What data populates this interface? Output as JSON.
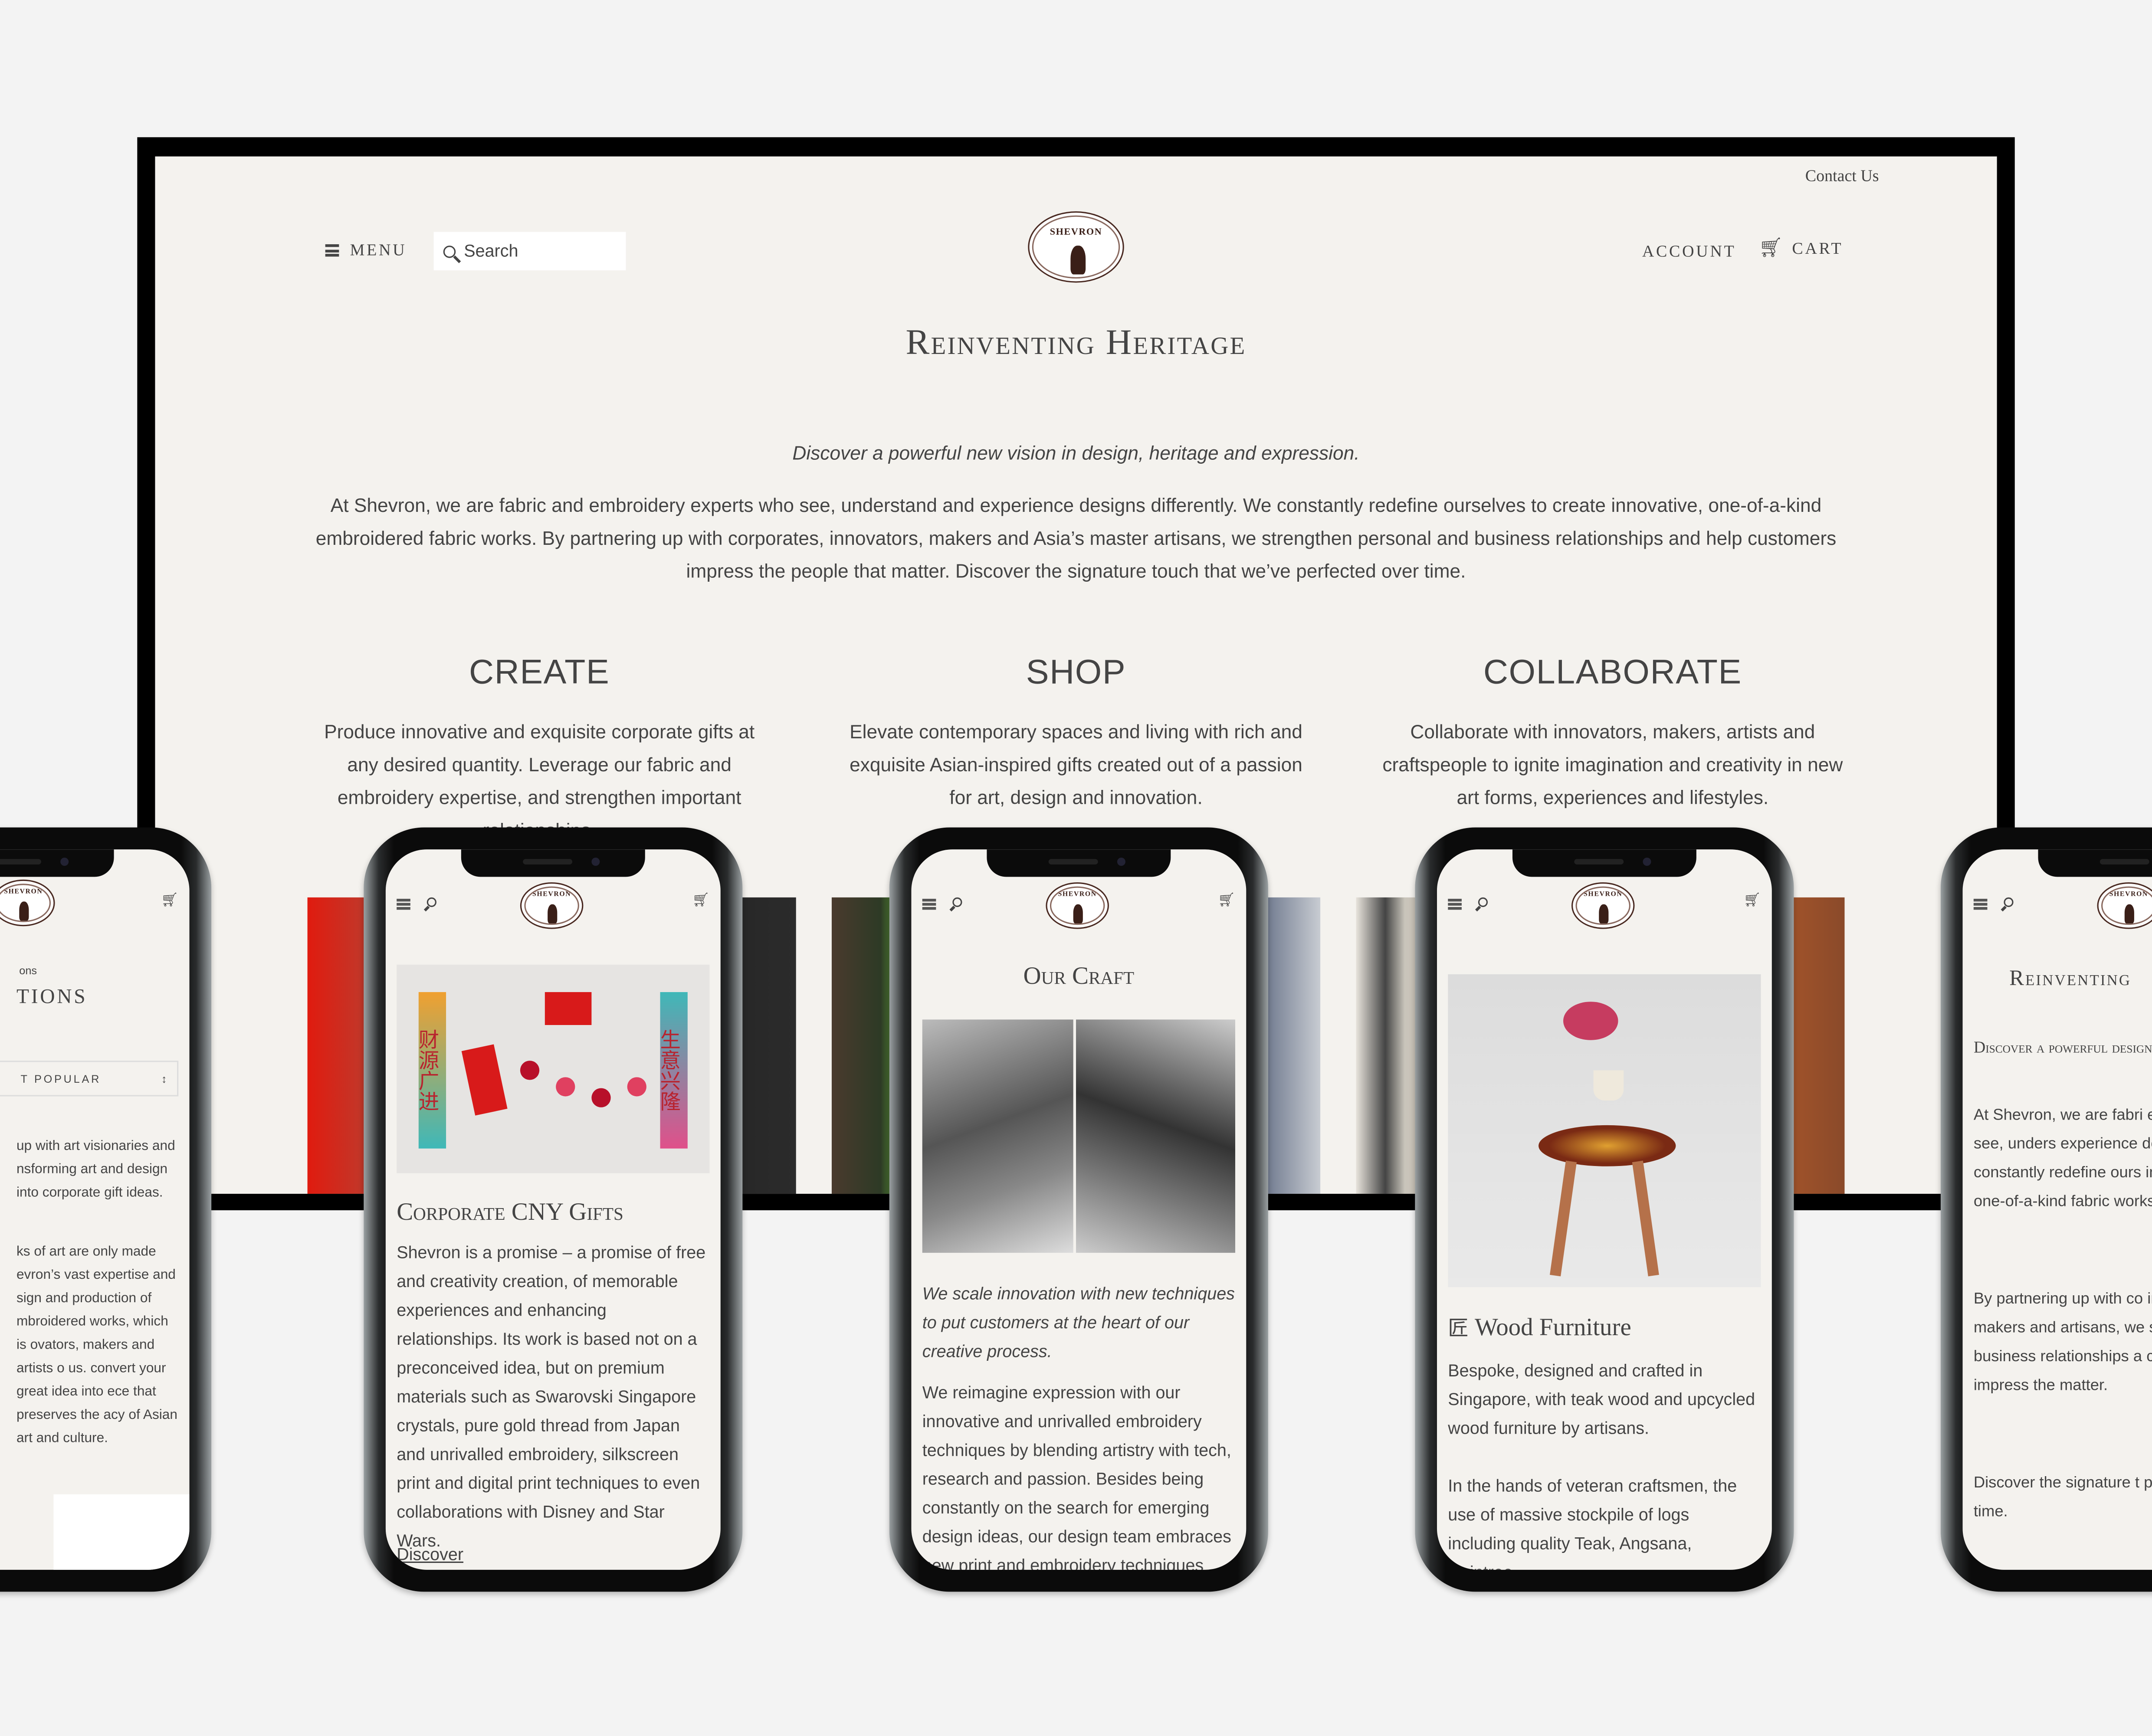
{
  "desktop": {
    "top_link": "Contact Us",
    "menu_label": "MENU",
    "search_placeholder": "Search",
    "logo_text": "SHEVRON",
    "account_label": "ACCOUNT",
    "cart_label": "CART",
    "cart_icon": "🛒",
    "heading": "Reinventing Heritage",
    "tagline": "Discover a powerful new vision in design, heritage and expression.",
    "intro": "At Shevron, we are fabric and embroidery experts who see, understand and experience designs differently. We constantly redefine ourselves to create innovative, one-of-a-kind embroidered fabric works. By partnering up with corporates, innovators, makers and Asia’s master artisans, we strengthen personal and business relationships and help customers impress the people that matter. Discover the signature touch that we’ve perfected over time.",
    "columns": [
      {
        "heading": "CREATE",
        "text": "Produce innovative and exquisite corporate gifts at any desired quantity. Leverage our fabric and embroidery expertise, and strengthen important relationships."
      },
      {
        "heading": "SHOP",
        "text": "Elevate contemporary spaces and living with rich and exquisite Asian-inspired gifts created out of a passion for art, design and innovation."
      },
      {
        "heading": "COLLABORATE",
        "text": "Collaborate with innovators, makers, artists and craftspeople to ignite imagination and creativity in new art forms, experiences and lifestyles."
      }
    ]
  },
  "phones": [
    {
      "breadcrumb": "ons",
      "title": "TIONS",
      "sort_value": "T POPULAR",
      "paragraph1": "up with art visionaries and nsforming art and design into corporate gift ideas.",
      "paragraph2": "ks of art are only made evron’s vast expertise and sign and production of mbroidered works, which is ovators, makers and artists o us. convert your great idea into ece that preserves the acy of Asian art and culture."
    },
    {
      "title": "Corporate CNY Gifts",
      "body": "Shevron is a promise – a promise of free and creativity creation, of memorable experiences and enhancing relationships. Its work is based not on a preconceived idea, but on premium materials such as Swarovski Singapore crystals, pure gold thread from Japan and unrivalled embroidery, silkscreen print and digital print techniques to even collaborations with Disney and Star Wars.",
      "link": "Discover",
      "banner_left": "财源广进",
      "banner_right": "生意兴隆"
    },
    {
      "title": "Our Craft",
      "quote": "We scale innovation with new techniques to put customers at the heart of our creative process.",
      "body": "We reimagine expression with our innovative and unrivalled embroidery techniques by blending artistry with tech, research and passion. Besides being constantly on the search for emerging design ideas, our design team embraces new print and embroidery techniques"
    },
    {
      "title_icon": "匠",
      "title": "Wood Furniture",
      "body1": "Bespoke, designed and crafted in Singapore, with teak wood and upcycled wood furniture by artisans.",
      "body2": "In the hands of veteran craftsmen, the use of massive stockpile of logs including quality Teak, Angsana, Raintree,"
    },
    {
      "title": "Reinventing",
      "subtitle": "Discover a powerful design, heritage and",
      "p1": "At Shevron, we are fabri experts who see, unders experience designs diffe constantly redefine ours innovative, one-of-a-kind fabric works.",
      "p2": "By partnering up with co innovators, makers and artisans, we strengthen business relationships a customers impress the matter.",
      "p3": "Discover the signature t perfected over time."
    }
  ],
  "colors": {
    "page_bg": "#f3f3f3",
    "site_bg": "#f4f2ee",
    "text": "#444444",
    "logo_brown": "#3a1f18",
    "accent_red": "#c8102e"
  }
}
